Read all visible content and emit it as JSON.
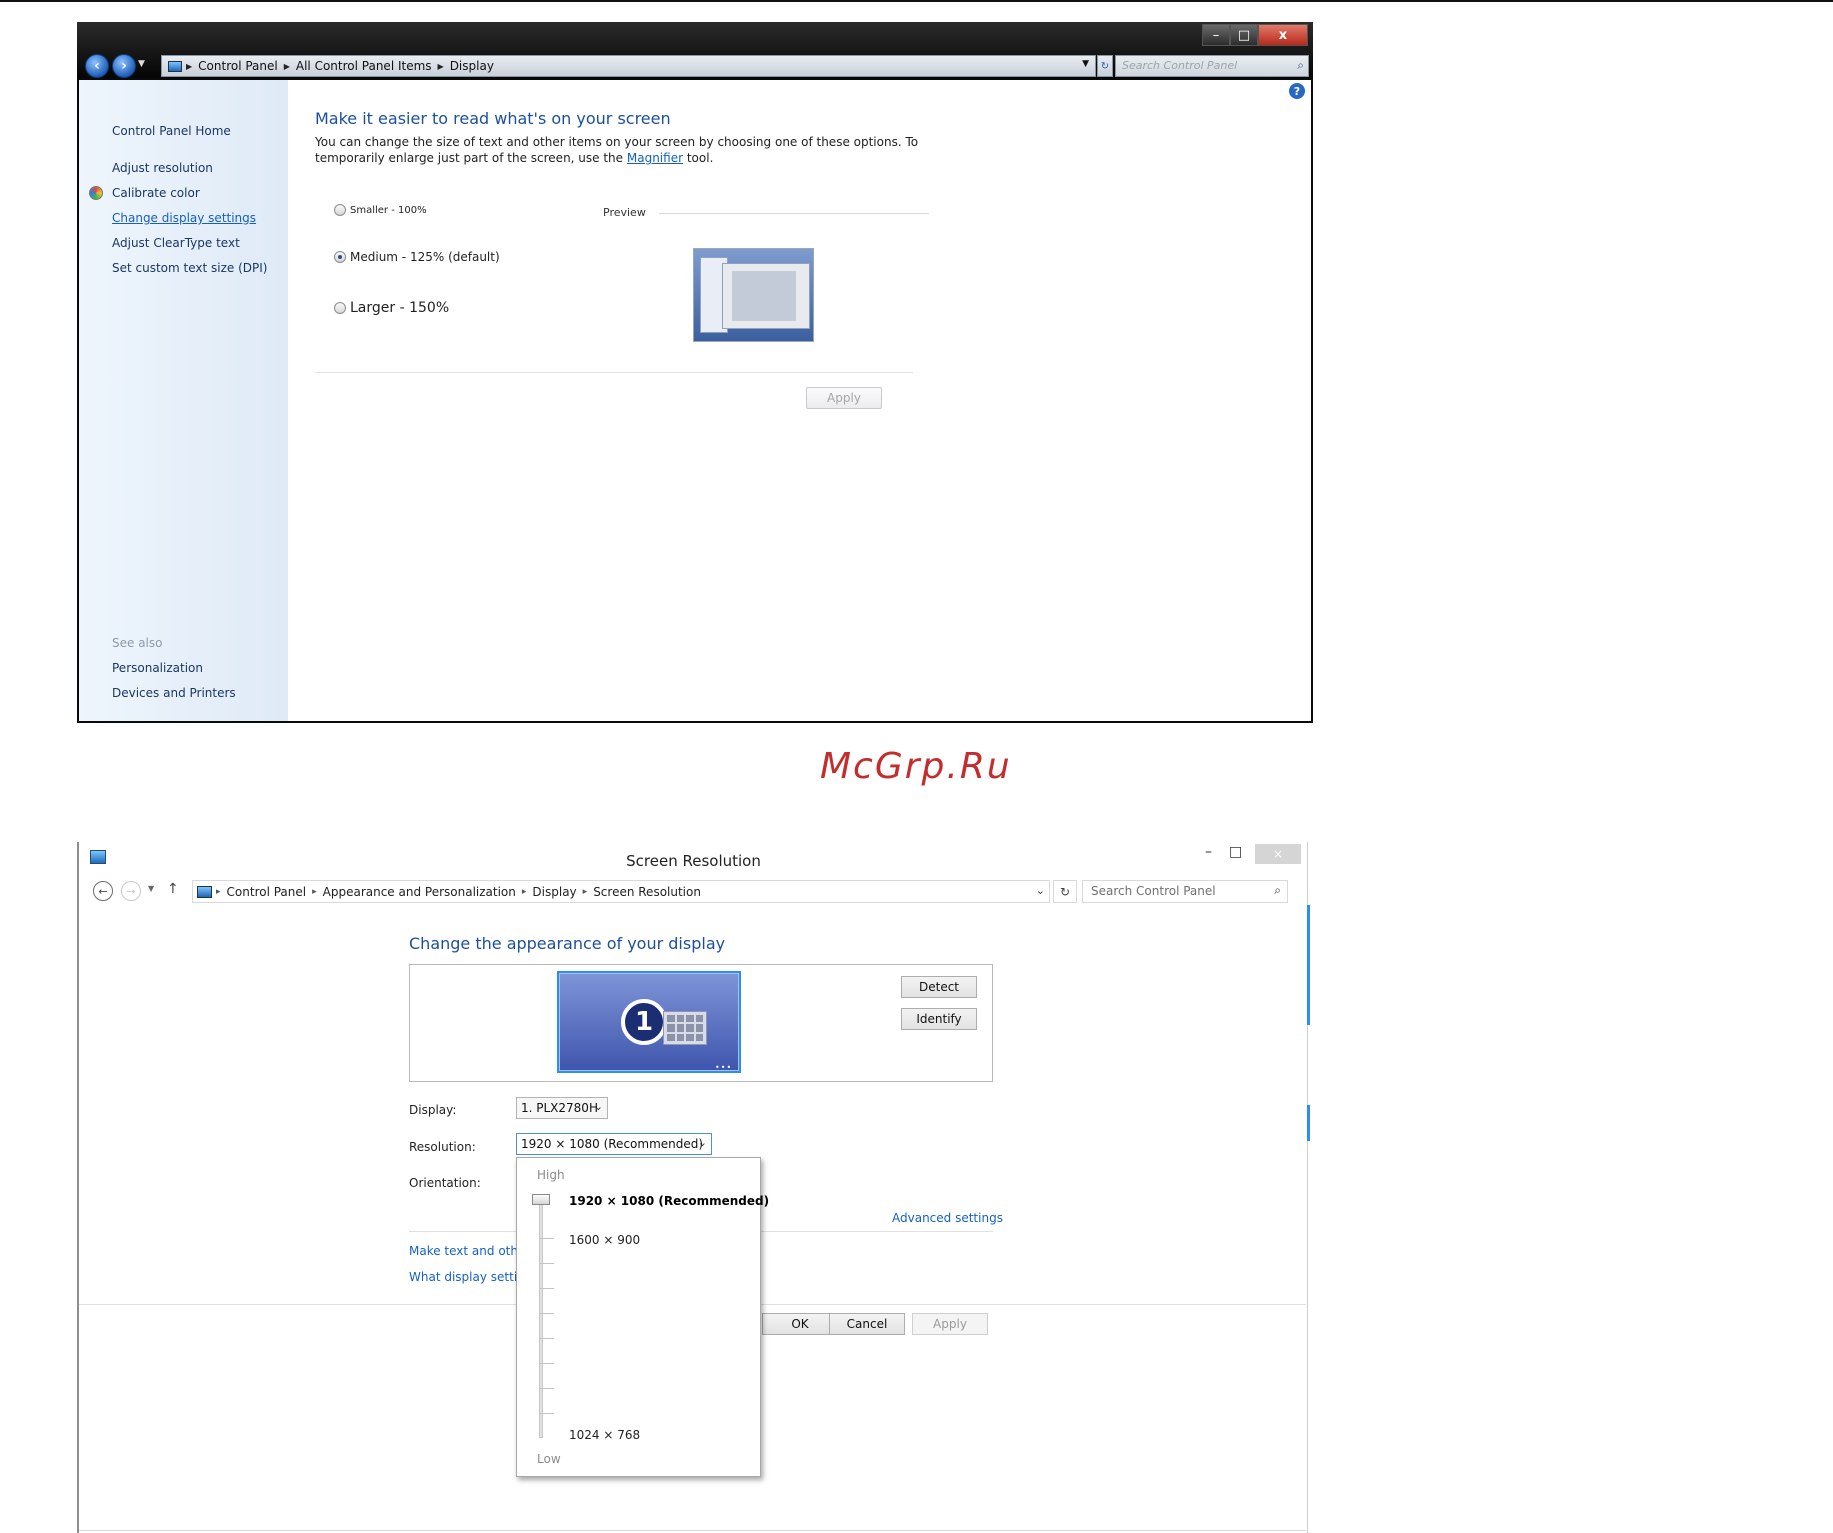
{
  "window1": {
    "caption": {
      "minimize": "–",
      "maximize": "□",
      "close": "x"
    },
    "breadcrumb": [
      "Control Panel",
      "All Control Panel Items",
      "Display"
    ],
    "search_placeholder": "Search Control Panel",
    "sidebar": {
      "items": [
        "Control Panel Home",
        "Adjust resolution",
        "Calibrate color",
        "Change display settings",
        "Adjust ClearType text",
        "Set custom text size (DPI)"
      ],
      "see_also_label": "See also",
      "see_also": [
        "Personalization",
        "Devices and Printers"
      ]
    },
    "heading": "Make it easier to read what's on your screen",
    "description_line1": "You can change the size of text and other items on your screen by choosing one of these options. To",
    "description_line2_pre": "temporarily enlarge just part of the screen, use the",
    "magnifier_link": "Magnifier",
    "description_line2_post": "tool.",
    "options": [
      "Smaller - 100%",
      "Medium - 125% (default)",
      "Larger - 150%"
    ],
    "selected_option": "Medium - 125% (default)",
    "preview_label": "Preview",
    "apply_label": "Apply"
  },
  "watermark": "McGrp.Ru",
  "window2": {
    "title": "Screen Resolution",
    "caption": {
      "minimize": "–",
      "maximize": "□",
      "close": "×"
    },
    "breadcrumb": [
      "Control Panel",
      "Appearance and Personalization",
      "Display",
      "Screen Resolution"
    ],
    "search_placeholder": "Search Control Panel",
    "heading": "Change the appearance of your display",
    "monitor_number": "1",
    "detect_label": "Detect",
    "identify_label": "Identify",
    "display_label": "Display:",
    "display_value": "1. PLX2780H",
    "resolution_label": "Resolution:",
    "resolution_value": "1920 × 1080 (Recommended)",
    "orientation_label": "Orientation:",
    "advanced_link": "Advanced settings",
    "link_text_size": "Make text and other",
    "link_what_settings": "What display setting",
    "ok_label": "OK",
    "cancel_label": "Cancel",
    "apply_label": "Apply",
    "resolution_dropdown": {
      "high_label": "High",
      "low_label": "Low",
      "options": [
        "1920 × 1080 (Recommended)",
        "1600 × 900",
        "1024 × 768"
      ],
      "selected": "1920 × 1080 (Recommended)"
    }
  }
}
